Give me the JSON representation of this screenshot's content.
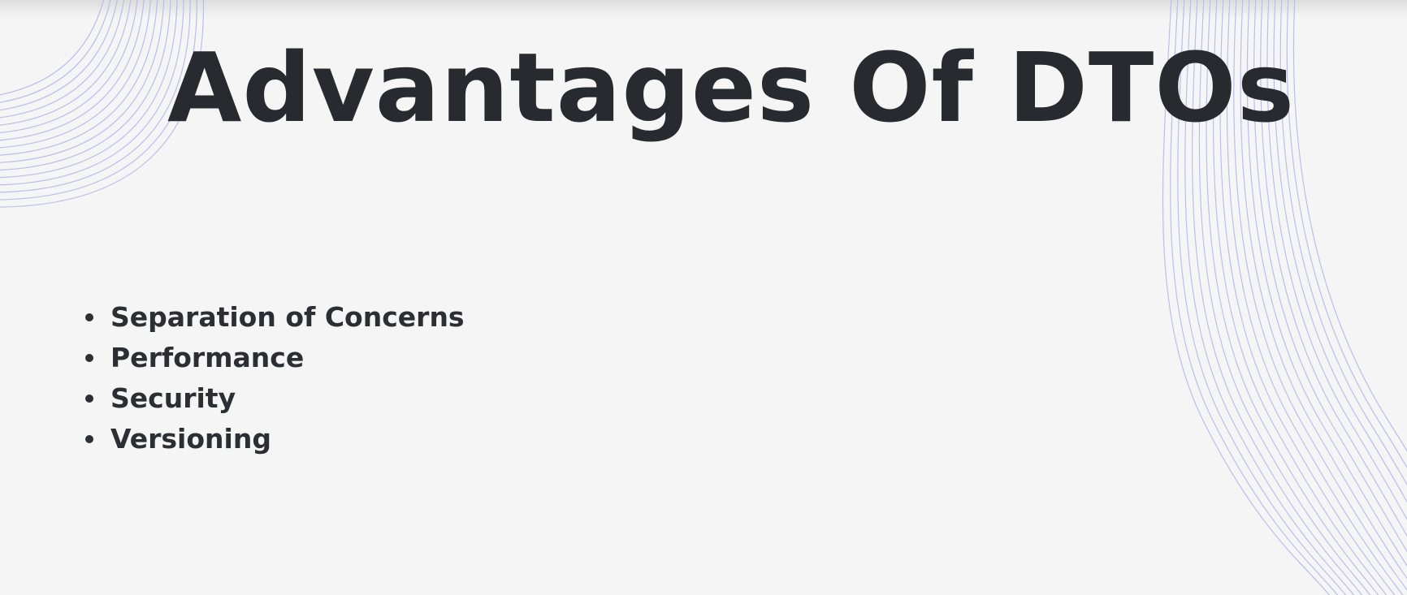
{
  "slide": {
    "title": "Advantages Of DTOs",
    "bullets": [
      "Separation of Concerns",
      "Performance",
      "Security",
      "Versioning"
    ]
  },
  "colors": {
    "background": "#f5f5f5",
    "text": "#272b30",
    "decor_lines": "#b8b6ea"
  },
  "icons": {
    "bullet": "bullet-dot-icon"
  }
}
